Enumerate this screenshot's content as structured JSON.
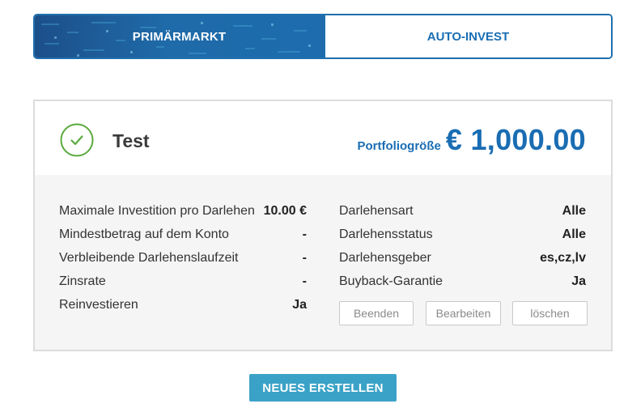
{
  "tabs": {
    "primary_label": "PRIMÄRMARKT",
    "auto_label": "AUTO-INVEST"
  },
  "card": {
    "title": "Test",
    "status_icon": "check-circle-icon",
    "portfolio_label": "Portfoliogröße",
    "portfolio_value": "€ 1,000.00",
    "left_rows": [
      {
        "label": "Maximale Investition pro Darlehen",
        "value": "10.00 €"
      },
      {
        "label": "Mindestbetrag auf dem Konto",
        "value": "-"
      },
      {
        "label": "Verbleibende Darlehenslaufzeit",
        "value": "-"
      },
      {
        "label": "Zinsrate",
        "value": "-"
      },
      {
        "label": "Reinvestieren",
        "value": "Ja"
      }
    ],
    "right_rows": [
      {
        "label": "Darlehensart",
        "value": "Alle"
      },
      {
        "label": "Darlehensstatus",
        "value": "Alle"
      },
      {
        "label": "Darlehensgeber",
        "value": "es,cz,lv"
      },
      {
        "label": "Buyback-Garantie",
        "value": "Ja"
      }
    ],
    "actions": {
      "end_label": "Beenden",
      "edit_label": "Bearbeiten",
      "delete_label": "löschen"
    }
  },
  "new_button_label": "NEUES ERSTELLEN",
  "colors": {
    "accent_blue": "#1a6db3",
    "success_green": "#5aaa3c",
    "button_teal": "#3aa2c7"
  }
}
